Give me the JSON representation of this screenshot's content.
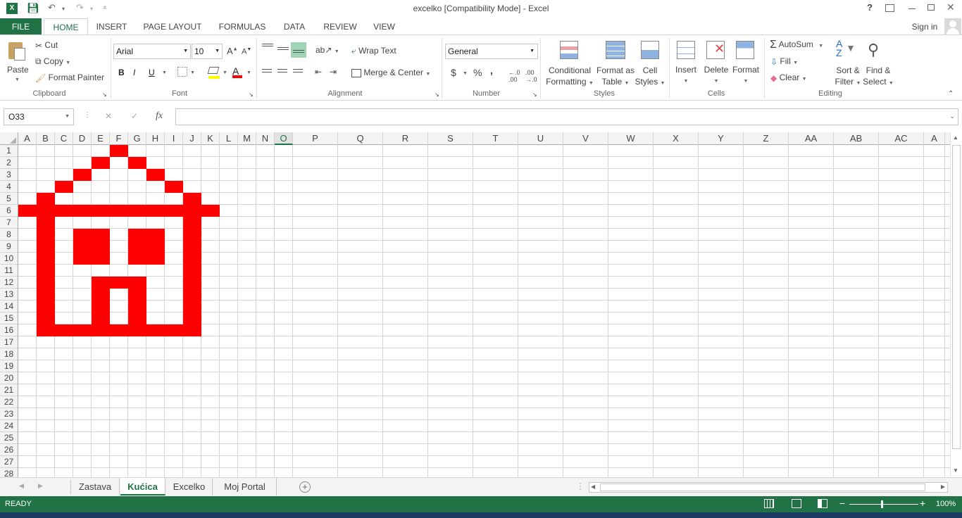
{
  "window": {
    "title": "excelko  [Compatibility Mode] - Excel",
    "help": "?",
    "sign_in": "Sign in"
  },
  "tabs": [
    "FILE",
    "HOME",
    "INSERT",
    "PAGE LAYOUT",
    "FORMULAS",
    "DATA",
    "REVIEW",
    "VIEW"
  ],
  "ribbon": {
    "clipboard": {
      "paste": "Paste",
      "cut": "Cut",
      "copy": "Copy",
      "format_painter": "Format Painter",
      "label": "Clipboard"
    },
    "font": {
      "name": "Arial",
      "size": "10",
      "bold": "B",
      "italic": "I",
      "underline": "U",
      "label": "Font"
    },
    "alignment": {
      "wrap_text": "Wrap Text",
      "merge_center": "Merge & Center",
      "label": "Alignment"
    },
    "number": {
      "format": "General",
      "currency": "$",
      "percent": "%",
      "comma": ",",
      "label": "Number"
    },
    "styles": {
      "conditional_1": "Conditional",
      "conditional_2": "Formatting",
      "format_table_1": "Format as",
      "format_table_2": "Table",
      "cell_styles_1": "Cell",
      "cell_styles_2": "Styles",
      "label": "Styles"
    },
    "cells": {
      "insert": "Insert",
      "delete": "Delete",
      "format": "Format",
      "label": "Cells"
    },
    "editing": {
      "autosum": "AutoSum",
      "fill": "Fill",
      "clear": "Clear",
      "sort_1": "Sort &",
      "sort_2": "Filter",
      "find_1": "Find &",
      "find_2": "Select",
      "label": "Editing"
    }
  },
  "formula_bar": {
    "name_box": "O33",
    "fx": "fx",
    "cancel": "✕",
    "enter": "✓",
    "value": ""
  },
  "grid": {
    "columns": [
      "A",
      "B",
      "C",
      "D",
      "E",
      "F",
      "G",
      "H",
      "I",
      "J",
      "K",
      "L",
      "M",
      "N",
      "O",
      "P",
      "Q",
      "R",
      "S",
      "T",
      "U",
      "V",
      "W",
      "X",
      "Y",
      "Z",
      "AA",
      "AB",
      "AC",
      "A"
    ],
    "selected_column": "O",
    "rows": [
      "1",
      "2",
      "3",
      "4",
      "5",
      "6",
      "7",
      "8",
      "9",
      "10",
      "11",
      "12",
      "13",
      "14",
      "15",
      "16",
      "17",
      "18",
      "19",
      "20",
      "21",
      "22",
      "23",
      "24",
      "25",
      "26",
      "27",
      "28"
    ],
    "fill_color": "#ff0000",
    "red_cells": [
      "F1",
      "E2",
      "G2",
      "D3",
      "H3",
      "C4",
      "I4",
      "B5",
      "J5",
      "A6",
      "B6",
      "C6",
      "D6",
      "E6",
      "F6",
      "G6",
      "H6",
      "I6",
      "J6",
      "K6",
      "B7",
      "J7",
      "B8",
      "D8",
      "E8",
      "G8",
      "H8",
      "J8",
      "B9",
      "D9",
      "E9",
      "G9",
      "H9",
      "J9",
      "B10",
      "D10",
      "E10",
      "G10",
      "H10",
      "J10",
      "B11",
      "J11",
      "B12",
      "E12",
      "F12",
      "G12",
      "J12",
      "B13",
      "E13",
      "G13",
      "J13",
      "B14",
      "E14",
      "G14",
      "J14",
      "B15",
      "E15",
      "G15",
      "J15",
      "B16",
      "C16",
      "D16",
      "E16",
      "F16",
      "G16",
      "H16",
      "I16",
      "J16"
    ]
  },
  "sheets": [
    "Zastava",
    "Kućica",
    "Excelko",
    "Moj Portal"
  ],
  "active_sheet": "Kućica",
  "status": {
    "ready": "READY",
    "zoom": "100%",
    "zoom_plus": "+",
    "zoom_minus": "−"
  },
  "colors": {
    "accent": "#217346",
    "red": "#ff0000"
  }
}
